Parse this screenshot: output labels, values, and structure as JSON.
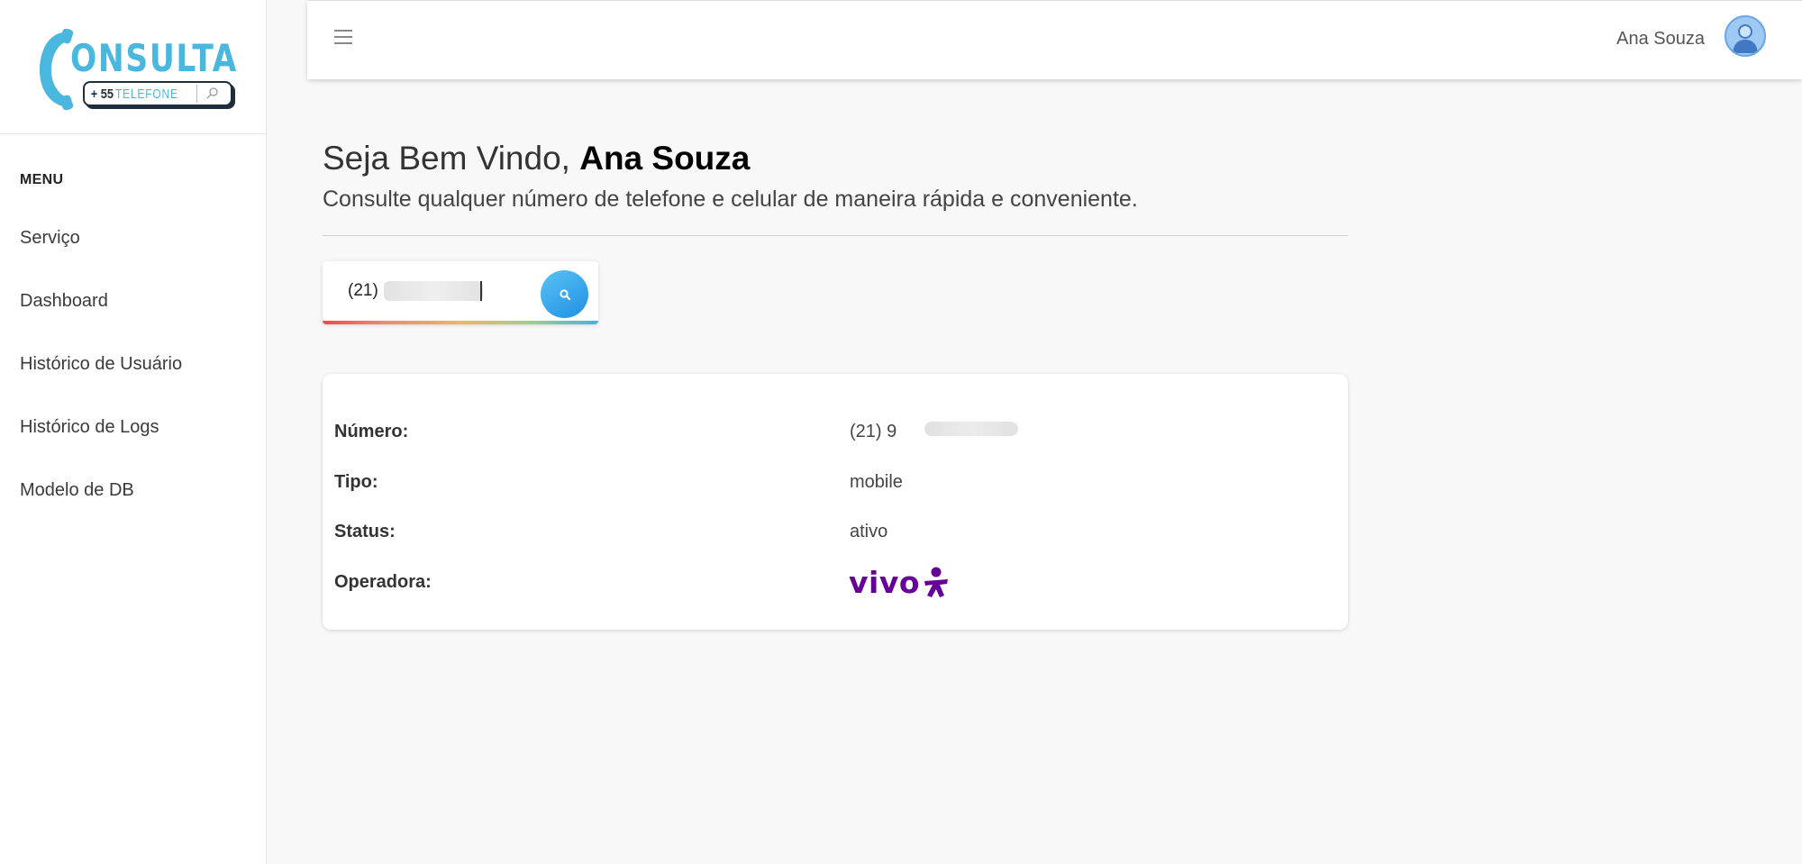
{
  "brand": {
    "logo_word": "ONSULTA",
    "logo_code": "+ 55",
    "logo_tel": "TELEFONE",
    "colors": {
      "primary": "#4ab8de",
      "dark": "#1f2d3d"
    }
  },
  "sidebar": {
    "menu_title": "MENU",
    "items": [
      {
        "label": "Serviço"
      },
      {
        "label": "Dashboard"
      },
      {
        "label": "Histórico de Usuário"
      },
      {
        "label": "Histórico de Logs"
      },
      {
        "label": "Modelo de DB"
      }
    ]
  },
  "topbar": {
    "menu_icon": "hamburger-icon",
    "user_name": "Ana Souza",
    "avatar_icon": "user-avatar-icon"
  },
  "main": {
    "welcome_prefix": "Seja Bem Vindo, ",
    "welcome_name": "Ana Souza",
    "subtitle": "Consulte qualquer número de telefone e celular de maneira rápida e conveniente.",
    "search": {
      "value": "(21)",
      "button_icon": "search-icon",
      "button_color": "#2a9be8"
    },
    "result": {
      "rows": [
        {
          "label": "Número:",
          "value": "(21) 9"
        },
        {
          "label": "Tipo:",
          "value": "mobile"
        },
        {
          "label": "Status:",
          "value": "ativo"
        },
        {
          "label": "Operadora:",
          "value": "vivo",
          "value_color": "#660099"
        }
      ]
    }
  }
}
